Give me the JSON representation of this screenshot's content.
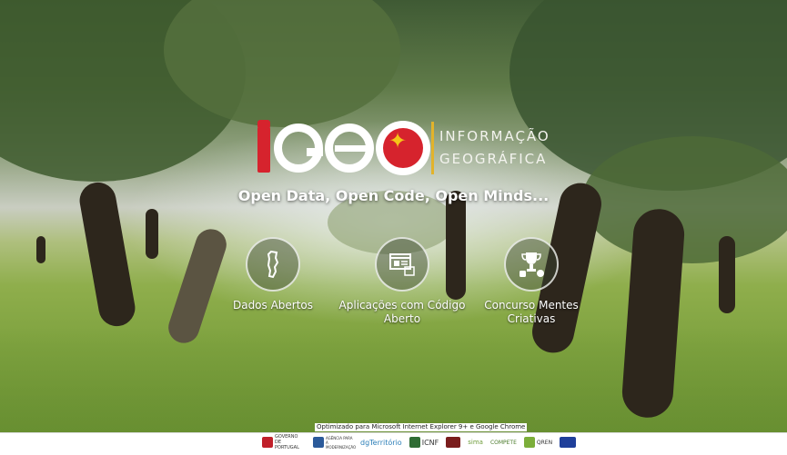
{
  "logo": {
    "brand_letters": "iGEO",
    "subtitle_line1": "INFORMAÇÃO",
    "subtitle_line2": "GEOGRÁFICA",
    "accent_red": "#d6232d",
    "accent_gold": "#e2b32b"
  },
  "tagline": "Open Data, Open Code, Open Minds...",
  "tiles": [
    {
      "label": "Dados Abertos",
      "icon": "portugal-map-icon"
    },
    {
      "label": "Aplicações com Código Aberto",
      "icon": "application-window-icon"
    },
    {
      "label": "Concurso Mentes Criativas",
      "icon": "trophy-icon"
    }
  ],
  "footer": {
    "note": "Optimizado para Microsoft Internet Explorer 9+ e Google Chrome",
    "partners": [
      {
        "name": "GOVERNO DE PORTUGAL",
        "color": "#c0202a"
      },
      {
        "name": "AGÊNCIA PARA A MODERNIZAÇÃO",
        "color": "#2b5a9a"
      },
      {
        "name": "dgTerritório",
        "color": "#2c7fb8"
      },
      {
        "name": "ICNF",
        "color": "#2f6c34"
      },
      {
        "name": "",
        "color": "#7a1d1d"
      },
      {
        "name": "sima",
        "color": "#6e9c3a"
      },
      {
        "name": "COMPETE",
        "color": "#88b04b"
      },
      {
        "name": "QREN",
        "color": "#7cae3a"
      },
      {
        "name": "EU",
        "color": "#1f3f9a"
      }
    ]
  }
}
